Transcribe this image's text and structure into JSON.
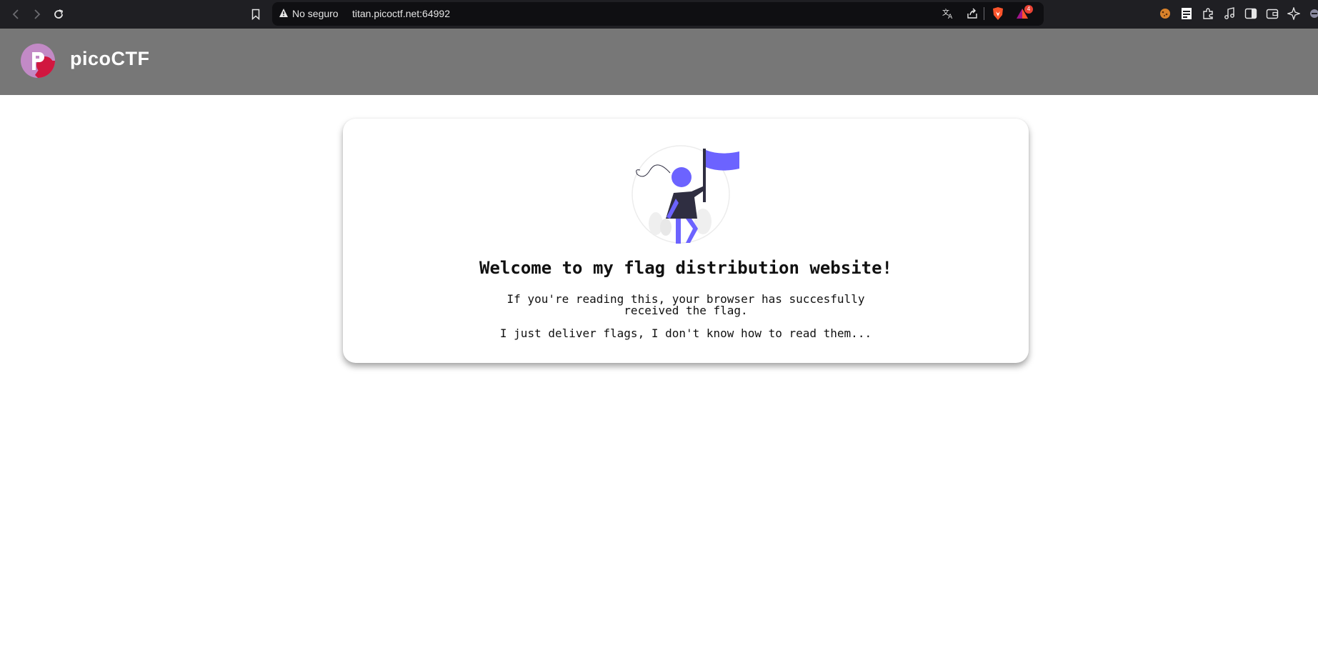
{
  "browser": {
    "security_label": "No seguro",
    "url": "titan.picoctf.net:64992",
    "rewards_badge_count": "4",
    "icons": [
      "back-icon",
      "forward-icon",
      "reload-icon",
      "bookmark-icon",
      "warning-icon",
      "translate-icon",
      "share-icon",
      "brave-shields-icon",
      "brave-rewards-icon",
      "cookie-extension-icon",
      "pdf-extension-icon",
      "extensions-icon",
      "media-icon",
      "sidebar-icon",
      "wallet-icon",
      "leo-ai-icon"
    ]
  },
  "header": {
    "site_name": "picoCTF"
  },
  "card": {
    "title": "Welcome to my flag distribution website!",
    "text_line1": "If you're reading this, your browser has succesfully",
    "text_line2": "received the flag.",
    "text_line3": "I just deliver flags, I don't know how to read them..."
  },
  "colors": {
    "browser_bar": "#1f1f23",
    "header_bg": "#777777",
    "accent_purple": "#6c63ff",
    "logo_red": "#d1173f"
  }
}
